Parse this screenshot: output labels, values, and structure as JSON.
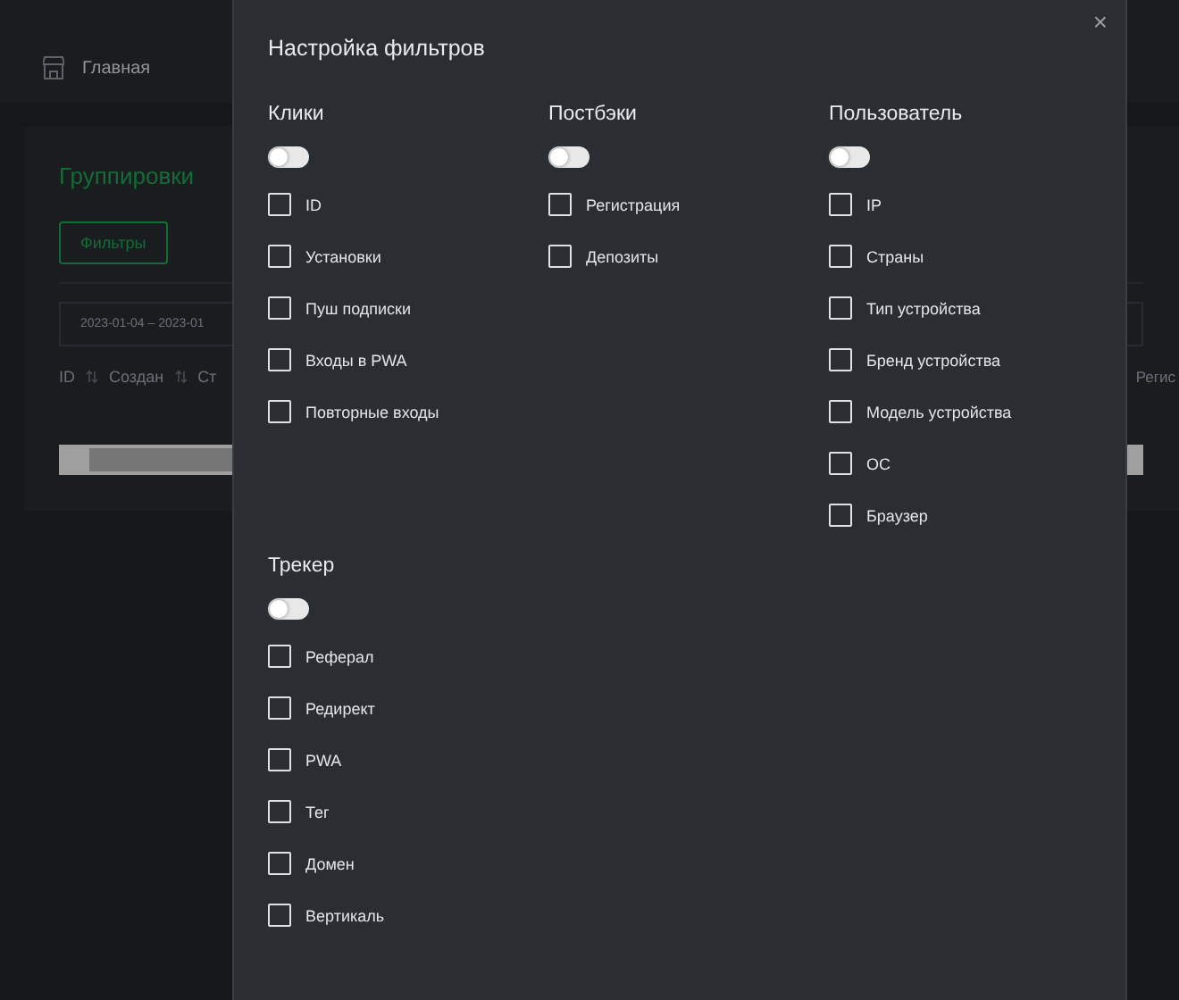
{
  "page": {
    "nav_item": "Главная",
    "title": "Группировки",
    "filters_button": "Фильтры",
    "date_range": "2023-01-04 – 2023-01",
    "columns": [
      "ID",
      "Создан",
      "Ст"
    ],
    "right_column": "Регис"
  },
  "modal": {
    "title": "Настройка фильтров",
    "close": "×",
    "groups": [
      {
        "title": "Клики",
        "on": false,
        "items": [
          {
            "label": "ID",
            "checked": false
          },
          {
            "label": "Установки",
            "checked": false
          },
          {
            "label": "Пуш подписки",
            "checked": false
          },
          {
            "label": "Входы в PWA",
            "checked": false
          },
          {
            "label": "Повторные входы",
            "checked": false
          }
        ]
      },
      {
        "title": "Постбэки",
        "on": false,
        "items": [
          {
            "label": "Регистрация",
            "checked": false
          },
          {
            "label": "Депозиты",
            "checked": false
          }
        ]
      },
      {
        "title": "Пользователь",
        "on": false,
        "items": [
          {
            "label": "IP",
            "checked": false
          },
          {
            "label": "Страны",
            "checked": false
          },
          {
            "label": "Тип устройства",
            "checked": false
          },
          {
            "label": "Бренд устройства",
            "checked": false
          },
          {
            "label": "Модель устройства",
            "checked": false
          },
          {
            "label": "ОС",
            "checked": false
          },
          {
            "label": "Браузер",
            "checked": false
          }
        ]
      },
      {
        "title": "Трекер",
        "on": false,
        "items": [
          {
            "label": "Реферал",
            "checked": false
          },
          {
            "label": "Редирект",
            "checked": false
          },
          {
            "label": "PWA",
            "checked": false
          },
          {
            "label": "Тег",
            "checked": false
          },
          {
            "label": "Домен",
            "checked": false
          },
          {
            "label": "Вертикаль",
            "checked": false
          }
        ]
      }
    ]
  }
}
